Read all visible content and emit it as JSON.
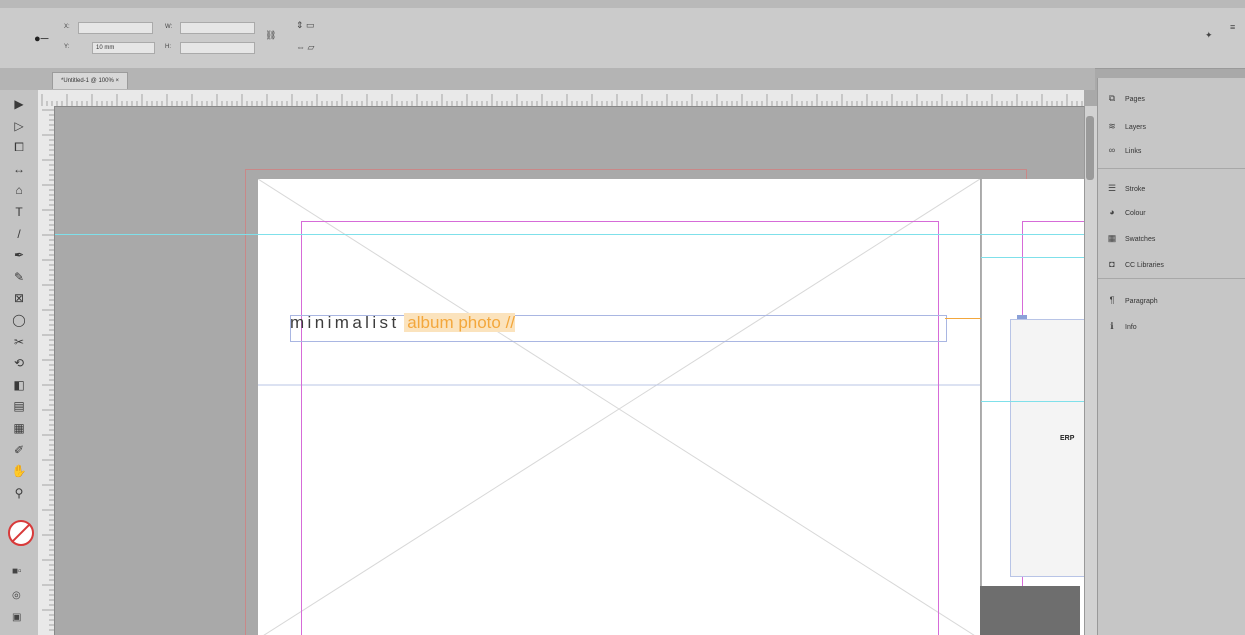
{
  "colors": {
    "accent_orange": "#f3a73c",
    "guide_cyan": "#7fe0ea",
    "margin_magenta": "#d66bd8",
    "bleed_red": "#d07a7a",
    "page_white": "#ffffff"
  },
  "control_bar": {
    "field_units_value": "10 mm"
  },
  "document_tab": {
    "label": "*Untitled-1 @ 100% ×"
  },
  "toolbox": {
    "tools": [
      {
        "name": "selection-tool-icon",
        "glyph": "▶"
      },
      {
        "name": "direct-selection-tool-icon",
        "glyph": "▷"
      },
      {
        "name": "page-tool-icon",
        "glyph": "⧠"
      },
      {
        "name": "gap-tool-icon",
        "glyph": "↔"
      },
      {
        "name": "content-collector-icon",
        "glyph": "⌂"
      },
      {
        "name": "type-tool-icon",
        "glyph": "T"
      },
      {
        "name": "line-tool-icon",
        "glyph": "/"
      },
      {
        "name": "pen-tool-icon",
        "glyph": "✒"
      },
      {
        "name": "pencil-tool-icon",
        "glyph": "✎"
      },
      {
        "name": "rectangle-frame-tool-icon",
        "glyph": "⊠"
      },
      {
        "name": "ellipse-tool-icon",
        "glyph": "◯"
      },
      {
        "name": "scissors-tool-icon",
        "glyph": "✂"
      },
      {
        "name": "free-transform-tool-icon",
        "glyph": "⟲"
      },
      {
        "name": "gradient-swatch-tool-icon",
        "glyph": "◧"
      },
      {
        "name": "gradient-feather-tool-icon",
        "glyph": "▤"
      },
      {
        "name": "note-tool-icon",
        "glyph": "▦"
      },
      {
        "name": "eyedropper-tool-icon",
        "glyph": "✐"
      },
      {
        "name": "hand-tool-icon",
        "glyph": "✋"
      },
      {
        "name": "zoom-tool-icon",
        "glyph": "⚲"
      }
    ]
  },
  "panels": {
    "items": [
      {
        "name": "pages",
        "label": "Pages",
        "glyph": "⧉"
      },
      {
        "name": "layers",
        "label": "Layers",
        "glyph": "≋"
      },
      {
        "name": "links",
        "label": "Links",
        "glyph": "∞"
      },
      {
        "name": "stroke",
        "label": "Stroke",
        "glyph": "☰"
      },
      {
        "name": "colour",
        "label": "Colour",
        "glyph": "◕"
      },
      {
        "name": "swatches",
        "label": "Swatches",
        "glyph": "▦"
      },
      {
        "name": "cc-libraries",
        "label": "CC Libraries",
        "glyph": "◘"
      },
      {
        "name": "paragraph",
        "label": "Paragraph",
        "glyph": "¶"
      },
      {
        "name": "info",
        "label": "Info",
        "glyph": "ℹ"
      }
    ]
  },
  "canvas": {
    "headline_main": "minimalist",
    "headline_accent": "album photo //",
    "right_page_partial_text": "ERP"
  }
}
